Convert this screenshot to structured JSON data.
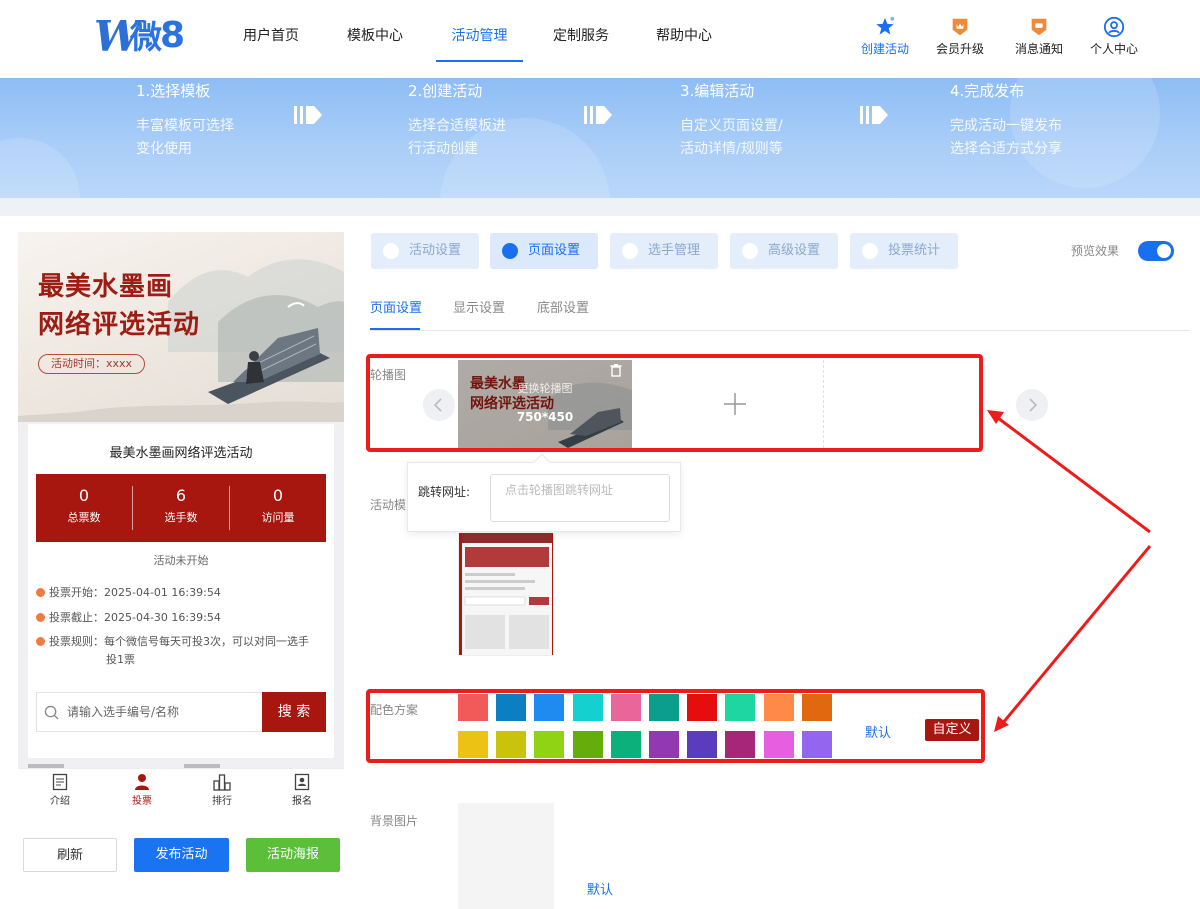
{
  "header": {
    "logo_w": "W",
    "logo_wei": "微",
    "logo_eight": "8",
    "nav": [
      "用户首页",
      "模板中心",
      "活动管理",
      "定制服务",
      "帮助中心"
    ],
    "tools": [
      "创建活动",
      "会员升级",
      "消息通知",
      "个人中心"
    ]
  },
  "banner": {
    "steps": [
      {
        "title": "1.选择模板",
        "line1": "丰富模板可选择",
        "line2": "变化使用"
      },
      {
        "title": "2.创建活动",
        "line1": "选择合适模板进",
        "line2": "行活动创建"
      },
      {
        "title": "3.编辑活动",
        "line1": "自定义页面设置/",
        "line2": "活动详情/规则等"
      },
      {
        "title": "4.完成发布",
        "line1": "完成活动一键发布",
        "line2": "选择合适方式分享"
      }
    ]
  },
  "preview": {
    "cover_title_1": "最美水墨画",
    "cover_title_2": "网络评选活动",
    "cover_time": "活动时间：xxxx",
    "title": "最美水墨画网络评选活动",
    "stats": [
      {
        "value": "0",
        "label": "总票数"
      },
      {
        "value": "6",
        "label": "选手数"
      },
      {
        "value": "0",
        "label": "访问量"
      }
    ],
    "status": "活动未开始",
    "vote_start": "投票开始：2025-04-01 16:39:54",
    "vote_end": "投票截止：2025-04-30 16:39:54",
    "rule_1": "投票规则：每个微信号每天可投3次，可以对同一选手",
    "rule_2": "投1票",
    "search_placeholder": "请输入选手编号/名称",
    "search_button": "搜 索",
    "tabbar": [
      "介绍",
      "投票",
      "排行",
      "报名"
    ]
  },
  "actions": {
    "refresh": "刷新",
    "publish": "发布活动",
    "poster": "活动海报"
  },
  "editor": {
    "main_tabs": [
      "活动设置",
      "页面设置",
      "选手管理",
      "高级设置",
      "投票统计"
    ],
    "preview_label": "预览效果",
    "sub_tabs": [
      "页面设置",
      "显示设置",
      "底部设置"
    ],
    "carousel_label": "轮播图",
    "carousel_cover_1": "最美水墨",
    "carousel_cover_2": "网络评选活动",
    "carousel_overlay": "更换轮播图",
    "carousel_size": "750*450",
    "jump_label": "跳转网址:",
    "jump_placeholder": "点击轮播图跳转网址",
    "template_label": "活动模",
    "color_label": "配色方案",
    "color_default": "默认",
    "color_custom": "自定义",
    "bg_label": "背景图片",
    "bg_default": "默认",
    "swatches_row1": [
      "#f25a5a",
      "#0c7ec2",
      "#1f8bf0",
      "#14d1cf",
      "#e8669a",
      "#0b9e8c",
      "#e50d0d",
      "#1ed6a0",
      "#ff8a47",
      "#e0680f"
    ],
    "swatches_row2": [
      "#ecc314",
      "#c9c40b",
      "#8fd314",
      "#64ad0a",
      "#0bb07a",
      "#9238b0",
      "#5b3cbf",
      "#a82678",
      "#e85ee0",
      "#9466f0"
    ]
  }
}
